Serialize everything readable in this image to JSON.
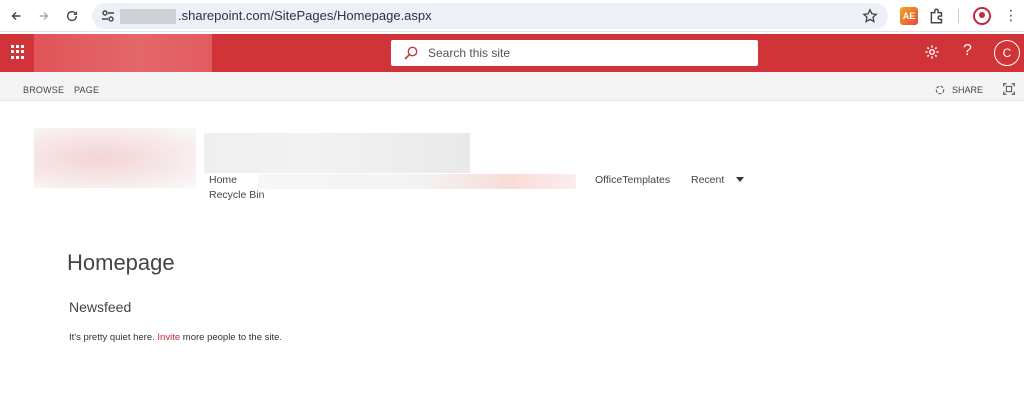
{
  "browser": {
    "url_text": ".sharepoint.com/SitePages/Homepage.aspx",
    "icons": [
      "back-icon",
      "forward-icon",
      "reload-icon",
      "site-settings-icon",
      "star-icon",
      "extension-icon",
      "puzzle-icon",
      "profile-icon",
      "kebab-icon"
    ]
  },
  "suitebar": {
    "search_placeholder": "Search this site",
    "help_label": "?",
    "user_initial": "C",
    "accent": "#d13438"
  },
  "ribbon": {
    "tabs": [
      "BROWSE",
      "PAGE"
    ],
    "share_label": "SHARE"
  },
  "topnav": {
    "items": [
      "Home",
      "Recycle Bin",
      "OfficeTemplates",
      "Recent"
    ]
  },
  "content": {
    "page_title": "Homepage",
    "section_title": "Newsfeed",
    "message_before": "It's pretty quiet here. ",
    "invite_label": "Invite",
    "message_after": " more people to the site.",
    "link_color": "#c5283d"
  }
}
